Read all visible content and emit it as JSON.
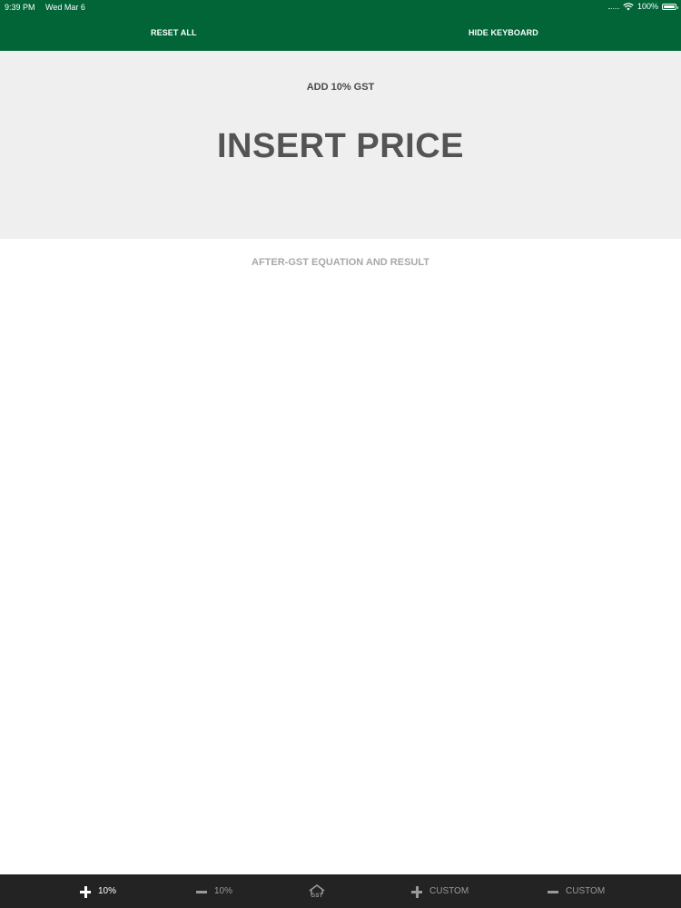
{
  "status_bar": {
    "time": "9:39 PM",
    "date": "Wed Mar 6",
    "battery": "100%",
    "battery_level": 1.0
  },
  "nav": {
    "reset_label": "RESET ALL",
    "hide_keyboard_label": "HIDE KEYBOARD"
  },
  "input_panel": {
    "mode_label": "ADD 10% GST",
    "price_placeholder": "INSERT PRICE",
    "price_value": ""
  },
  "result": {
    "label": "AFTER-GST EQUATION AND RESULT"
  },
  "tabs": [
    {
      "label": "10%",
      "icon": "plus-icon",
      "active": true
    },
    {
      "label": "10%",
      "icon": "minus-icon",
      "active": false
    },
    {
      "label": "GST",
      "icon": "gst-house-icon",
      "active": false
    },
    {
      "label": "CUSTOM",
      "icon": "plus-icon",
      "active": false
    },
    {
      "label": "CUSTOM",
      "icon": "minus-icon",
      "active": false
    }
  ],
  "colors": {
    "brand_green": "#016538",
    "input_panel_bg": "#efeff0",
    "tabbar_bg": "#232323",
    "active_tab": "#ffffff",
    "inactive_tab": "#9a9a9a"
  }
}
